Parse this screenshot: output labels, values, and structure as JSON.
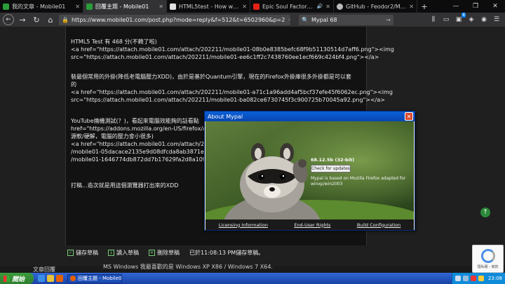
{
  "tabs": [
    {
      "title": "我的文章 - Mobile01",
      "color": "#2a9d3a",
      "active": false
    },
    {
      "title": "回覆主題 - Mobile01",
      "color": "#2a9d3a",
      "active": true
    },
    {
      "title": "HTML5test - How well does yo",
      "color": "#e0e0e0",
      "active": false
    },
    {
      "title": "Epic Soul Factory - Sigma (",
      "color": "#e62117",
      "active": false,
      "audio": true
    },
    {
      "title": "GitHub - Feodor2/Mypal68: w",
      "color": "#bbbbbb",
      "active": false
    }
  ],
  "nav": {
    "url": "https://www.mobile01.com/post.php?mode=reply&f=512&t=6502960&p=2",
    "search": "Mypal 68",
    "badge_count": "4"
  },
  "post": {
    "lines": [
      "HTML5 Test 有 468 分(不賴了啦)",
      "<a href=\"https://attach.mobile01.com/attach/202211/mobile01-08b0e8385befc68f9b51130514d7aff6.png\"><img",
      "src=\"https://attach.mobile01.com/attach/202211/mobile01-ee6c1ff2c7438760ee1ecf669c424bf4.png\"></a>",
      "",
      "裝最個常用的外掛(降低老電腦壓力XDD)，由於是基於Quantum引擎，現在的Firefox外掛庫很多外掛都是可以套",
      "的",
      "<a href=\"https://attach.mobile01.com/attach/202211/mobile01-a71c1a96add4af5bcf37efe45f6062ec.png\"><img",
      "src=\"https://attach.mobile01.com/attach/202211/mobile01-ba082ce6730745f3c900725b70045a92.png\"></a>",
      "",
      "YouTube燒機測試(？)，看起來電腦效能夠的話看點",
      "href=\"https://addons.mozilla.org/en-US/firefox/addon/",
      "源軟/硬解，電腦的壓力會小很多)",
      "<a href=\"https://attach.mobile01.com/attach/202211",
      "/mobile01-05dacace2135e9d08dfcda8ab3871e60.p",
      "/mobile01-1646774db872dd7b17629fa2d8a109f7.p",
      "",
      "打稿...造次就是用這個瀏覽器打出來的XDD"
    ]
  },
  "actions": {
    "save_draft": "儲存草稿",
    "load_draft": "讀入草稿",
    "delete_draft": "刪除草稿",
    "saved_status": "已於11:08:13 PM儲存草稿。"
  },
  "footer": {
    "reply_label": "文章回覆",
    "os_line": "MS Windows 我最喜歡的是 Windows XP X86 / Windows 7 X64."
  },
  "captcha": {
    "text": "隱私權 - 條款"
  },
  "about_dialog": {
    "title": "About Mypal",
    "close": "✕",
    "version": "68.12.5b (32-bit)",
    "check_updates": "Check for updates",
    "based_on": "Mypal is based on Mozilla Firefox adapted for winxp/win2003",
    "links": [
      "Licensing Information",
      "End-User Rights",
      "Build Configuration"
    ]
  },
  "taskbar": {
    "start": "開始",
    "task": "回覆主題 - Mobile01 ...",
    "clock": "23:08"
  }
}
